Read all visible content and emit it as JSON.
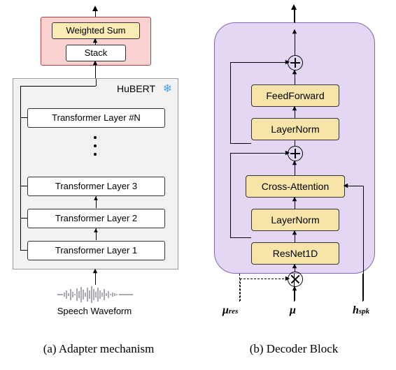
{
  "left": {
    "top_box": {
      "weighted_sum": "Weighted Sum",
      "stack": "Stack"
    },
    "hubert_label": "HuBERT",
    "layers": {
      "n": "Transformer Layer #N",
      "l3": "Transformer Layer 3",
      "l2": "Transformer Layer 2",
      "l1": "Transformer Layer 1"
    },
    "speech_label": "Speech Waveform",
    "icon_name": "snowflake-icon"
  },
  "right": {
    "blocks": {
      "feedforward": "FeedForward",
      "layernorm_top": "LayerNorm",
      "cross_attention": "Cross-Attention",
      "layernorm_bottom": "LayerNorm",
      "resnet": "ResNet1D"
    },
    "inputs": {
      "mu_res": "μ",
      "mu_res_sub": "res",
      "mu": "μ",
      "h_spk": "h",
      "h_spk_sub": "spk"
    }
  },
  "captions": {
    "a": "(a) Adapter mechanism",
    "b": "(b) Decoder Block"
  }
}
